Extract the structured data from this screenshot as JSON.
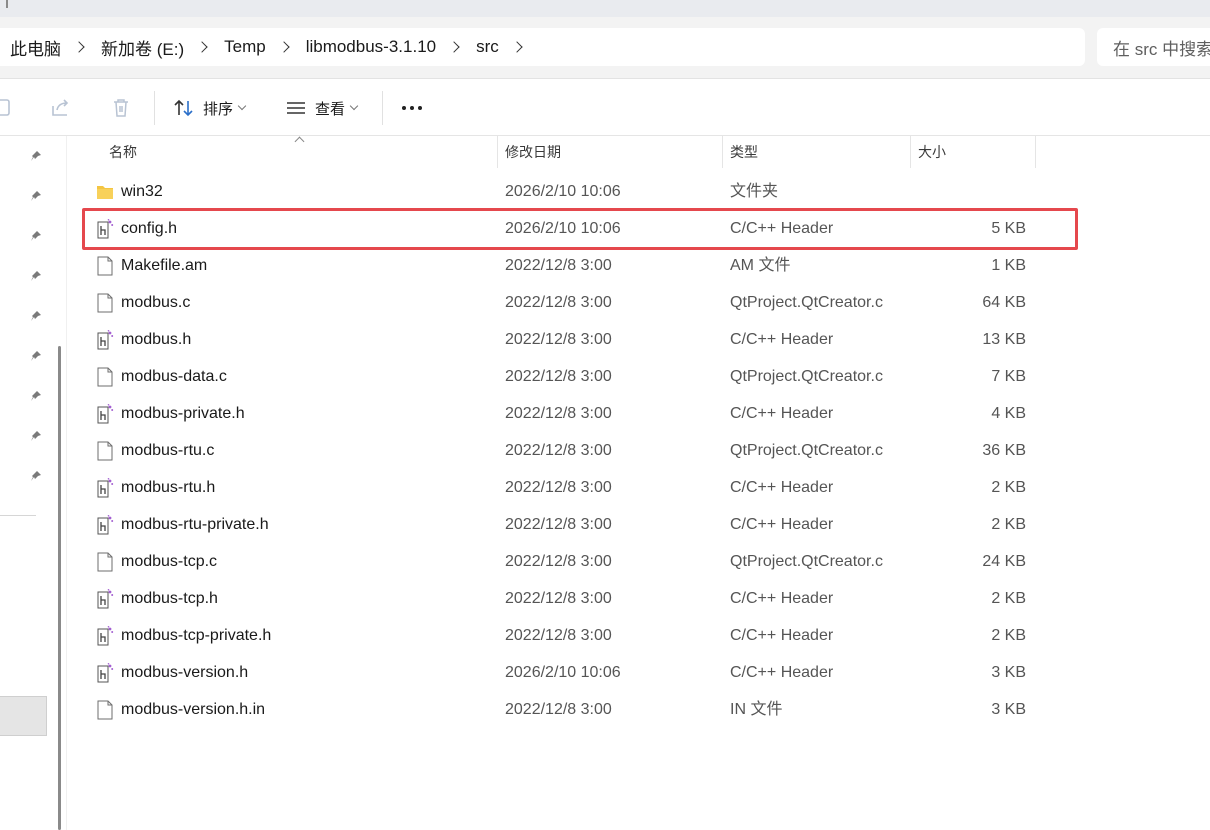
{
  "breadcrumb": [
    "此电脑",
    "新加卷 (E:)",
    "Temp",
    "libmodbus-3.1.10",
    "src"
  ],
  "search": {
    "placeholder": "在 src 中搜索"
  },
  "toolbar": {
    "sort_label": "排序",
    "view_label": "查看"
  },
  "columns": {
    "name": "名称",
    "date": "修改日期",
    "type": "类型",
    "size": "大小"
  },
  "files": [
    {
      "name": "win32",
      "date": "2026/2/10 10:06",
      "type": "文件夹",
      "size": "",
      "icon": "folder-icon"
    },
    {
      "name": "config.h",
      "date": "2026/2/10 10:06",
      "type": "C/C++ Header",
      "size": "5 KB",
      "icon": "header-file-icon"
    },
    {
      "name": "Makefile.am",
      "date": "2022/12/8 3:00",
      "type": "AM 文件",
      "size": "1 KB",
      "icon": "file-icon"
    },
    {
      "name": "modbus.c",
      "date": "2022/12/8 3:00",
      "type": "QtProject.QtCreator.c",
      "size": "64 KB",
      "icon": "file-icon"
    },
    {
      "name": "modbus.h",
      "date": "2022/12/8 3:00",
      "type": "C/C++ Header",
      "size": "13 KB",
      "icon": "header-file-icon"
    },
    {
      "name": "modbus-data.c",
      "date": "2022/12/8 3:00",
      "type": "QtProject.QtCreator.c",
      "size": "7 KB",
      "icon": "file-icon"
    },
    {
      "name": "modbus-private.h",
      "date": "2022/12/8 3:00",
      "type": "C/C++ Header",
      "size": "4 KB",
      "icon": "header-file-icon"
    },
    {
      "name": "modbus-rtu.c",
      "date": "2022/12/8 3:00",
      "type": "QtProject.QtCreator.c",
      "size": "36 KB",
      "icon": "file-icon"
    },
    {
      "name": "modbus-rtu.h",
      "date": "2022/12/8 3:00",
      "type": "C/C++ Header",
      "size": "2 KB",
      "icon": "header-file-icon"
    },
    {
      "name": "modbus-rtu-private.h",
      "date": "2022/12/8 3:00",
      "type": "C/C++ Header",
      "size": "2 KB",
      "icon": "header-file-icon"
    },
    {
      "name": "modbus-tcp.c",
      "date": "2022/12/8 3:00",
      "type": "QtProject.QtCreator.c",
      "size": "24 KB",
      "icon": "file-icon"
    },
    {
      "name": "modbus-tcp.h",
      "date": "2022/12/8 3:00",
      "type": "C/C++ Header",
      "size": "2 KB",
      "icon": "header-file-icon"
    },
    {
      "name": "modbus-tcp-private.h",
      "date": "2022/12/8 3:00",
      "type": "C/C++ Header",
      "size": "2 KB",
      "icon": "header-file-icon"
    },
    {
      "name": "modbus-version.h",
      "date": "2026/2/10 10:06",
      "type": "C/C++ Header",
      "size": "3 KB",
      "icon": "header-file-icon"
    },
    {
      "name": "modbus-version.h.in",
      "date": "2022/12/8 3:00",
      "type": "IN 文件",
      "size": "3 KB",
      "icon": "file-icon"
    }
  ],
  "highlight": {
    "file": "config.h",
    "color": "#e5484d"
  },
  "colors": {
    "folder": "#f4c542",
    "header_icon_accent": "#a35fd1",
    "pin": "#7a7a7a"
  }
}
